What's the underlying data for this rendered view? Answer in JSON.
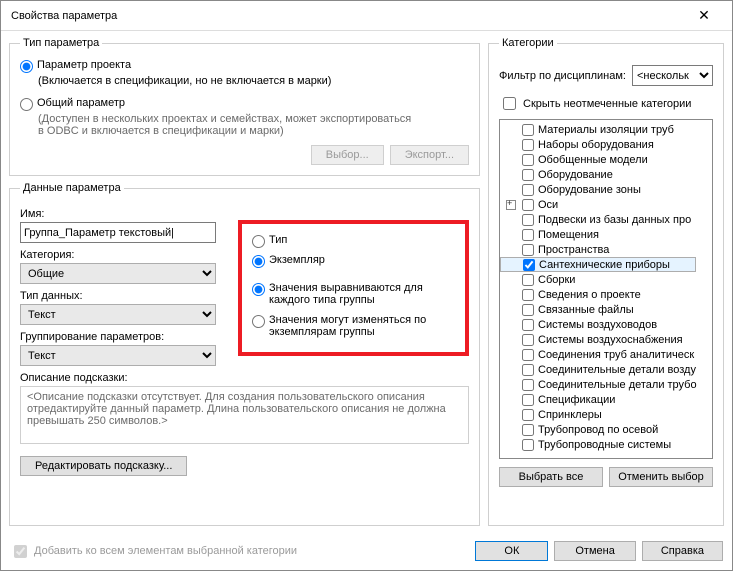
{
  "title": "Свойства параметра",
  "paramType": {
    "legend": "Тип параметра",
    "project": "Параметр проекта",
    "projectNote": "(Включается в спецификации, но не включается в марки)",
    "shared": "Общий параметр",
    "sharedNote": "(Доступен в нескольких проектах и семействах, может экспортироваться в ODBC и включается в спецификации и марки)",
    "selectBtn": "Выбор...",
    "exportBtn": "Экспорт..."
  },
  "paramData": {
    "legend": "Данные параметра",
    "nameLabel": "Имя:",
    "nameValue": "Группа_Параметр текстовый|",
    "disciplineLabel": "Категория:",
    "disciplineValue": "Общие",
    "typeLabel": "Тип данных:",
    "typeValue": "Текст",
    "groupLabel": "Группирование параметров:",
    "groupValue": "Текст",
    "radioType": "Тип",
    "radioInstance": "Экземпляр",
    "radioAlign": "Значения выравниваются для каждого типа группы",
    "radioVary": "Значения могут изменяться по экземплярам группы",
    "tooltipLabel": "Описание подсказки:",
    "tooltipText": "<Описание подсказки отсутствует. Для создания пользовательского описания отредактируйте данный параметр. Длина пользовательского описания не должна превышать 250 символов.>",
    "editTooltipBtn": "Редактировать подсказку..."
  },
  "categories": {
    "legend": "Категории",
    "filterLabel": "Фильтр по дисциплинам:",
    "filterValue": "<нескольк",
    "hideUnchecked": "Скрыть неотмеченные категории",
    "items": [
      {
        "label": "Материалы изоляции труб",
        "checked": false,
        "exp": false
      },
      {
        "label": "Наборы оборудования",
        "checked": false,
        "exp": false
      },
      {
        "label": "Обобщенные модели",
        "checked": false,
        "exp": false
      },
      {
        "label": "Оборудование",
        "checked": false,
        "exp": false
      },
      {
        "label": "Оборудование зоны",
        "checked": false,
        "exp": false
      },
      {
        "label": "Оси",
        "checked": false,
        "exp": true
      },
      {
        "label": "Подвески из базы данных про",
        "checked": false,
        "exp": false
      },
      {
        "label": "Помещения",
        "checked": false,
        "exp": false
      },
      {
        "label": "Пространства",
        "checked": false,
        "exp": false
      },
      {
        "label": "Сантехнические приборы",
        "checked": true,
        "exp": false,
        "sel": true
      },
      {
        "label": "Сборки",
        "checked": false,
        "exp": false
      },
      {
        "label": "Сведения о проекте",
        "checked": false,
        "exp": false
      },
      {
        "label": "Связанные файлы",
        "checked": false,
        "exp": false
      },
      {
        "label": "Системы воздуховодов",
        "checked": false,
        "exp": false
      },
      {
        "label": "Системы воздухоснабжения",
        "checked": false,
        "exp": false
      },
      {
        "label": "Соединения труб аналитическ",
        "checked": false,
        "exp": false
      },
      {
        "label": "Соединительные детали возду",
        "checked": false,
        "exp": false
      },
      {
        "label": "Соединительные детали трубо",
        "checked": false,
        "exp": false
      },
      {
        "label": "Спецификации",
        "checked": false,
        "exp": false
      },
      {
        "label": "Спринклеры",
        "checked": false,
        "exp": false
      },
      {
        "label": "Трубопровод по осевой",
        "checked": false,
        "exp": false
      },
      {
        "label": "Трубопроводные системы",
        "checked": false,
        "exp": false
      }
    ],
    "selectAll": "Выбрать все",
    "deselectAll": "Отменить выбор"
  },
  "footer": {
    "addAll": "Добавить ко всем элементам выбранной категории",
    "ok": "ОК",
    "cancel": "Отмена",
    "help": "Справка"
  }
}
